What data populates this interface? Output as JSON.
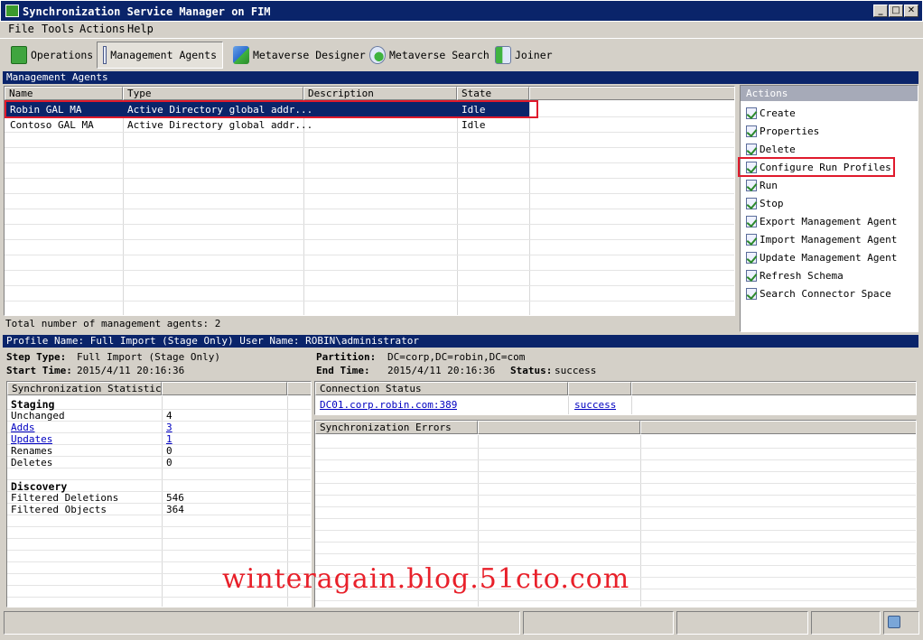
{
  "window": {
    "title": "Synchronization Service Manager on FIM"
  },
  "menu": [
    "File",
    "Tools",
    "Actions",
    "Help"
  ],
  "toolbar": [
    {
      "label": "Operations",
      "icon": "operations-icon",
      "active": false
    },
    {
      "label": "Management Agents",
      "icon": "management-agents-icon",
      "active": true
    },
    {
      "label": "Metaverse Designer",
      "icon": "metaverse-designer-icon",
      "active": false
    },
    {
      "label": "Metaverse Search",
      "icon": "metaverse-search-icon",
      "active": false
    },
    {
      "label": "Joiner",
      "icon": "joiner-icon",
      "active": false
    }
  ],
  "ma_panel": {
    "header": "Management Agents",
    "columns": [
      "Name",
      "Type",
      "Description",
      "State"
    ],
    "rows": [
      {
        "name": "Robin GAL MA",
        "type": "Active Directory global addr...",
        "description": "",
        "state": "Idle",
        "selected": true
      },
      {
        "name": "Contoso GAL MA",
        "type": "Active Directory global addr...",
        "description": "",
        "state": "Idle",
        "selected": false
      }
    ],
    "total": "Total number of management agents: 2"
  },
  "actions": {
    "header": "Actions",
    "items": [
      "Create",
      "Properties",
      "Delete",
      "Configure Run Profiles",
      "Run",
      "Stop",
      "Export Management Agent",
      "Import Management Agent",
      "Update Management Agent",
      "Refresh Schema",
      "Search Connector Space"
    ],
    "highlighted": "Configure Run Profiles"
  },
  "profile": {
    "strip": "Profile Name: Full Import (Stage Only)  User Name: ROBIN\\administrator",
    "step_type_label": "Step Type:",
    "step_type": "Full Import (Stage Only)",
    "start_time_label": "Start Time:",
    "start_time": "2015/4/11 20:16:36",
    "partition_label": "Partition:",
    "partition": "DC=corp,DC=robin,DC=com",
    "end_time_label": "End Time:",
    "end_time": "2015/4/11 20:16:36",
    "status_label": "Status:",
    "status": "success"
  },
  "sync_stats": {
    "header": "Synchronization Statistics",
    "staging_title": "Staging",
    "staging": [
      {
        "label": "Unchanged",
        "value": "4",
        "link": false
      },
      {
        "label": "Adds",
        "value": "3",
        "link": true
      },
      {
        "label": "Updates",
        "value": "1",
        "link": true
      },
      {
        "label": "Renames",
        "value": "0",
        "link": false
      },
      {
        "label": "Deletes",
        "value": "0",
        "link": false
      }
    ],
    "discovery_title": "Discovery",
    "discovery": [
      {
        "label": "Filtered Deletions",
        "value": "546"
      },
      {
        "label": "Filtered Objects",
        "value": "364"
      }
    ]
  },
  "connection": {
    "header": "Connection Status",
    "server": "DC01.corp.robin.com:389",
    "status": "success"
  },
  "errors": {
    "header": "Synchronization Errors"
  },
  "watermark": "winteragain.blog.51cto.com"
}
